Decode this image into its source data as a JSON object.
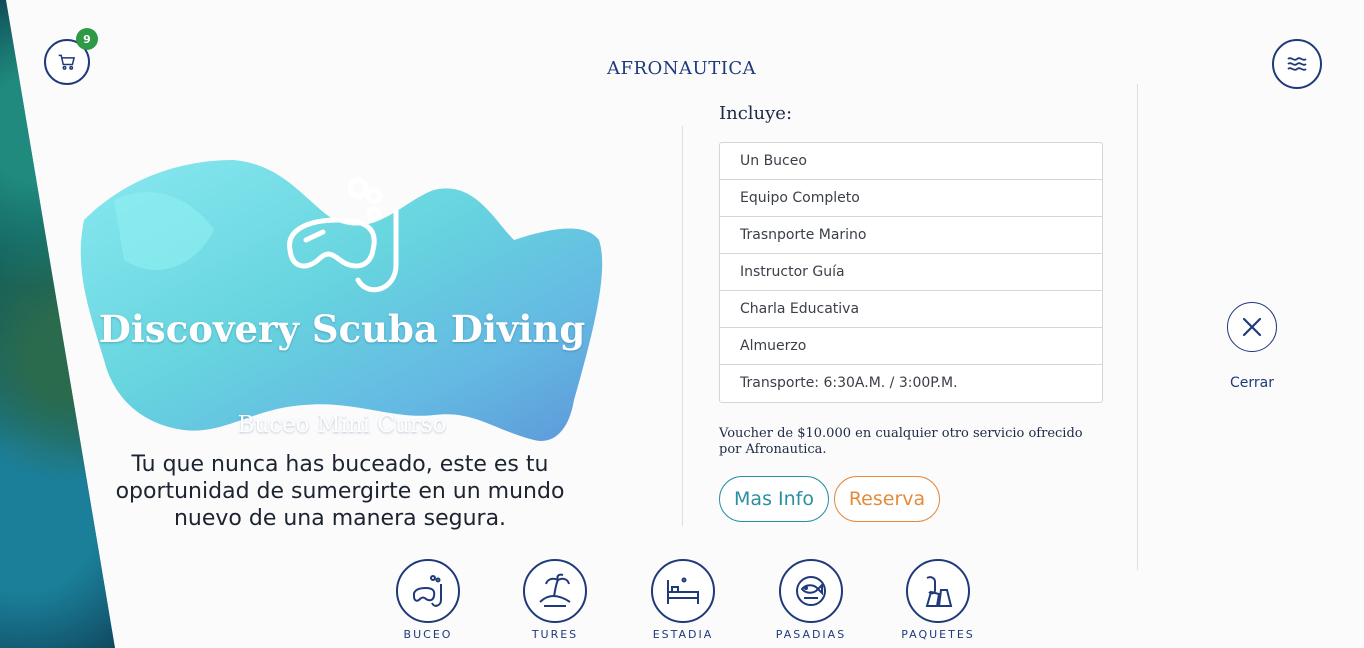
{
  "header": {
    "logo_text": "AFRONAUTICA",
    "cart_count": "9",
    "cart_icon": "cart-icon",
    "menu_icon": "wave-menu-icon"
  },
  "hero": {
    "title": "Discovery Scuba Diving",
    "subtitle": "Buceo Mini Curso",
    "description": "Tu que nunca has buceado, este es tu oportunidad de sumergirte en un mundo nuevo de una manera segura."
  },
  "includes": {
    "title": "Incluye:",
    "items": [
      "Un Buceo",
      "Equipo Completo",
      "Trasnporte Marino",
      "Instructor Guía",
      "Charla Educativa",
      "Almuerzo",
      "Transporte: 6:30A.M. / 3:00P.M."
    ],
    "voucher": "Voucher de $10.000 en cualquier otro servicio ofrecido por Afronautica."
  },
  "actions": {
    "info_label": "Mas Info",
    "reserve_label": "Reserva"
  },
  "close": {
    "label": "Cerrar"
  },
  "nav": [
    {
      "label": "BUCEO",
      "icon": "snorkel-icon"
    },
    {
      "label": "TURES",
      "icon": "island-icon"
    },
    {
      "label": "ESTADIA",
      "icon": "bed-icon"
    },
    {
      "label": "PASADIAS",
      "icon": "fish-icon"
    },
    {
      "label": "PAQUETES",
      "icon": "diving-gear-icon"
    }
  ],
  "colors": {
    "navy": "#1f3a7a",
    "badge": "#2e9a45",
    "info": "#2b8fa3",
    "reserve": "#e48a3a"
  }
}
